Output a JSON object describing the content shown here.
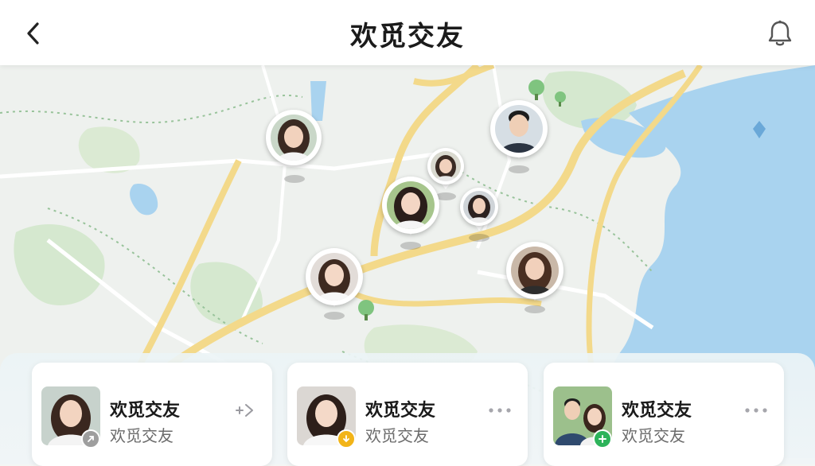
{
  "header": {
    "title": "欢觅交友",
    "back_icon": "chevron-left-icon",
    "notify_icon": "bell-icon"
  },
  "map": {
    "pins": [
      "pin-woman-1",
      "pin-woman-2",
      "pin-woman-3",
      "pin-woman-4",
      "pin-woman-5",
      "pin-man-1",
      "pin-woman-6"
    ]
  },
  "cards": [
    {
      "name": "欢觅交友",
      "sub": "欢觅交友",
      "badge_color": "#9e9e9e",
      "badge_icon": "arrow-icon",
      "action_icon": "send-icon"
    },
    {
      "name": "欢觅交友",
      "sub": "欢觅交友",
      "badge_color": "#f2b418",
      "badge_icon": "down-arrow-icon",
      "action_icon": "more-icon"
    },
    {
      "name": "欢觅交友",
      "sub": "欢觅交友",
      "badge_color": "#2db35a",
      "badge_icon": "plus-icon",
      "action_icon": "more-icon"
    }
  ],
  "colors": {
    "water": "#a9d3ef",
    "road": "#f3d98a",
    "park": "#cfe5c8"
  }
}
